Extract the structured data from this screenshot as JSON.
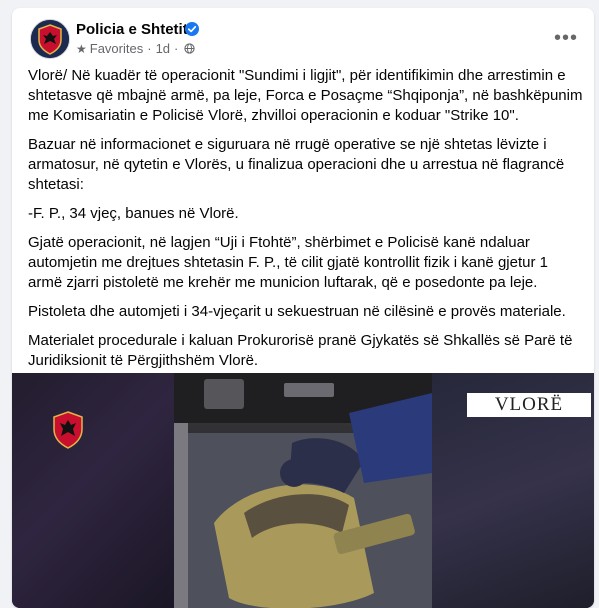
{
  "post": {
    "page_name": "Policia e Shtetit",
    "verified_icon": "verified-badge-icon",
    "audience_label": "Favorites",
    "separator": "·",
    "time": "1d",
    "privacy_icon": "globe-icon",
    "more_icon": "more-options-icon",
    "more_label": "•••",
    "paragraphs": [
      "Vlorë/ Në kuadër të operacionit \"Sundimi i ligjit\", për identifikimin dhe arrestimin e shtetasve që mbajnë armë, pa leje, Forca e Posaçme “Shqiponja”, në bashkëpunim me Komisariatin e Policisë Vlorë, zhvilloi operacionin e koduar \"Strike 10\".",
      "Bazuar në informacionet e siguruara në rrugë operative se një shtetas lëvizte i armatosur, në qytetin e Vlorës, u finalizua  operacioni dhe u arrestua në flagrancë shtetasi:",
      "-F. P., 34 vjeç, banues në Vlorë.",
      "Gjatë operacionit, në lagjen “Uji i Ftohtë”, shërbimet e Policisë kanë ndaluar automjetin me drejtues shtetasin F. P., të cilit gjatë kontrollit fizik i kanë gjetur 1 armë zjarri pistoletë me krehër me municion luftarak, që e posedonte pa leje.",
      "Pistoleta dhe automjeti i 34-vjeçarit u sekuestruan në cilësinë e provës materiale.",
      "Materialet procedurale i kaluan Prokurorisë pranë Gjykatës së Shkallës së Parë të Juridiksionit të Përgjithshëm Vlorë."
    ]
  },
  "media": {
    "location_label": "VLORË",
    "watermark_icon": "police-emblem-icon",
    "colors": {
      "emblem_red": "#c8102e",
      "bag_tan": "#a99a5c",
      "glove": "#2b2f4a",
      "sleeve": "#2a3a7a"
    }
  },
  "colors": {
    "background": "#f0f2f5",
    "card": "#ffffff",
    "text": "#050505",
    "secondary_text": "#65676b",
    "verified_blue": "#1877f2"
  }
}
